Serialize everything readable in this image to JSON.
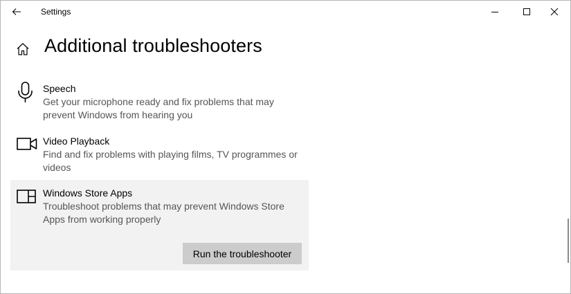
{
  "window": {
    "title": "Settings"
  },
  "icons": {
    "back": "back-arrow-icon",
    "minimize": "minimize-icon",
    "maximize": "maximize-icon",
    "close": "close-icon",
    "home": "home-icon"
  },
  "page": {
    "title": "Additional troubleshooters"
  },
  "troubleshooters": [
    {
      "title": "Speech",
      "description": "Get your microphone ready and fix problems that may prevent Windows from hearing you",
      "icon": "microphone-icon"
    },
    {
      "title": "Video Playback",
      "description": "Find and fix problems with playing films, TV programmes or videos",
      "icon": "video-camera-icon"
    },
    {
      "title": "Windows Store Apps",
      "description": "Troubleshoot problems that may prevent Windows Store Apps from working properly",
      "icon": "store-apps-icon",
      "selected": true,
      "button_label": "Run the troubleshooter"
    }
  ],
  "colors": {
    "selected_background": "#f2f2f2",
    "button_background": "#cccccc",
    "description_text": "#555555"
  }
}
